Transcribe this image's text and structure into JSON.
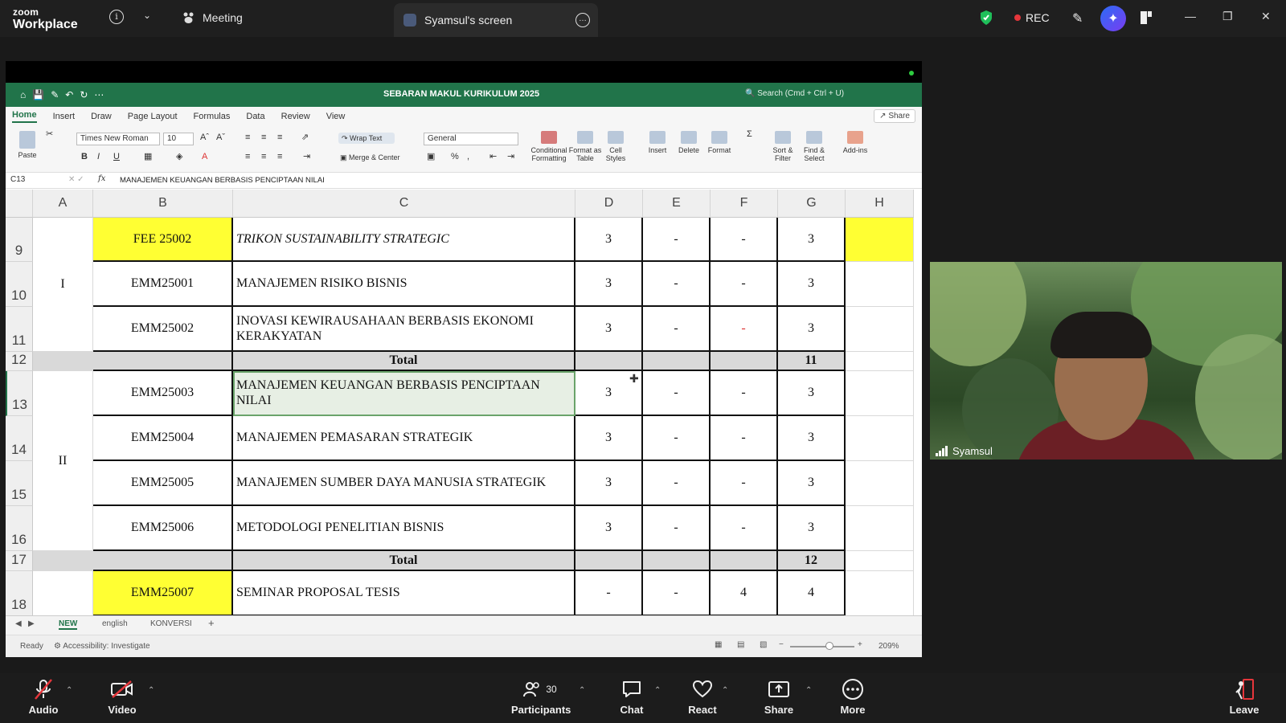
{
  "zoom": {
    "brand_top": "zoom",
    "brand_bottom": "Workplace",
    "meeting_label": "Meeting",
    "screen_tab_label": "Syamsul's screen",
    "rec_label": "REC",
    "toolbar": [
      {
        "key": "audio",
        "label": "Audio"
      },
      {
        "key": "video",
        "label": "Video"
      },
      {
        "key": "participants",
        "label": "Participants",
        "count": "30"
      },
      {
        "key": "chat",
        "label": "Chat"
      },
      {
        "key": "react",
        "label": "React"
      },
      {
        "key": "share",
        "label": "Share"
      },
      {
        "key": "more",
        "label": "More"
      },
      {
        "key": "leave",
        "label": "Leave"
      }
    ],
    "video_participant_name": "Syamsul"
  },
  "excel": {
    "doc_title": "SEBARAN MAKUL KURIKULUM 2025",
    "search_placeholder": "Search (Cmd + Ctrl + U)",
    "share_label": "Share",
    "ribbon_tabs": [
      "Home",
      "Insert",
      "Draw",
      "Page Layout",
      "Formulas",
      "Data",
      "Review",
      "View"
    ],
    "active_ribbon_tab": "Home",
    "ribbon": {
      "paste": "Paste",
      "font_name": "Times New Roman",
      "font_size": "10",
      "wrap_text": "Wrap Text",
      "merge_center": "Merge & Center",
      "number_format": "General",
      "conditional_formatting": "Conditional Formatting",
      "format_as_table": "Format as Table",
      "cell_styles": "Cell Styles",
      "insert": "Insert",
      "delete": "Delete",
      "format": "Format",
      "sort_filter": "Sort & Filter",
      "find_select": "Find & Select",
      "add_ins": "Add-ins"
    },
    "name_box": "C13",
    "formula_value": "MANAJEMEN KEUANGAN BERBASIS PENCIPTAAN NILAI",
    "columns": [
      "A",
      "B",
      "C",
      "D",
      "E",
      "F",
      "G",
      "H"
    ],
    "rows": [
      {
        "num": "9",
        "b": "FEE 25002",
        "c": "TRIKON SUSTAINABILITY STRATEGIC",
        "d": "3",
        "e": "-",
        "f": "-",
        "g": "3"
      },
      {
        "num": "10",
        "b": "EMM25001",
        "c": "MANAJEMEN RISIKO BISNIS",
        "d": "3",
        "e": "-",
        "f": "-",
        "g": "3"
      },
      {
        "num": "11",
        "b": "EMM25002",
        "c": "INOVASI KEWIRAUSAHAAN BERBASIS EKONOMI KERAKYATAN",
        "d": "3",
        "e": "-",
        "f": "-",
        "g": "3"
      },
      {
        "num": "12",
        "c": "Total",
        "g": "11"
      },
      {
        "num": "13",
        "b": "EMM25003",
        "c": "MANAJEMEN KEUANGAN BERBASIS PENCIPTAAN NILAI",
        "d": "3",
        "e": "-",
        "f": "-",
        "g": "3"
      },
      {
        "num": "14",
        "b": "EMM25004",
        "c": "MANAJEMEN PEMASARAN STRATEGIK",
        "d": "3",
        "e": "-",
        "f": "-",
        "g": "3"
      },
      {
        "num": "15",
        "b": "EMM25005",
        "c": "MANAJEMEN SUMBER DAYA MANUSIA STRATEGIK",
        "d": "3",
        "e": "-",
        "f": "-",
        "g": "3"
      },
      {
        "num": "16",
        "b": "EMM25006",
        "c": "METODOLOGI PENELITIAN BISNIS",
        "d": "3",
        "e": "-",
        "f": "-",
        "g": "3"
      },
      {
        "num": "17",
        "c": "Total",
        "g": "12"
      },
      {
        "num": "18",
        "b": "EMM25007",
        "c": "SEMINAR PROPOSAL TESIS",
        "d": "-",
        "e": "-",
        "f": "4",
        "g": "4"
      }
    ],
    "group_labels": {
      "group1": "I",
      "group2": "II"
    },
    "sheet_tabs": [
      "NEW",
      "english",
      "KONVERSI"
    ],
    "active_sheet": "NEW",
    "status_ready": "Ready",
    "status_accessibility": "Accessibility: Investigate",
    "zoom_level": "209%"
  },
  "colors": {
    "excel_green": "#21744a",
    "highlight_yellow": "#ffff33",
    "total_gray": "#d9d9d9",
    "rec_red": "#e5363b"
  }
}
